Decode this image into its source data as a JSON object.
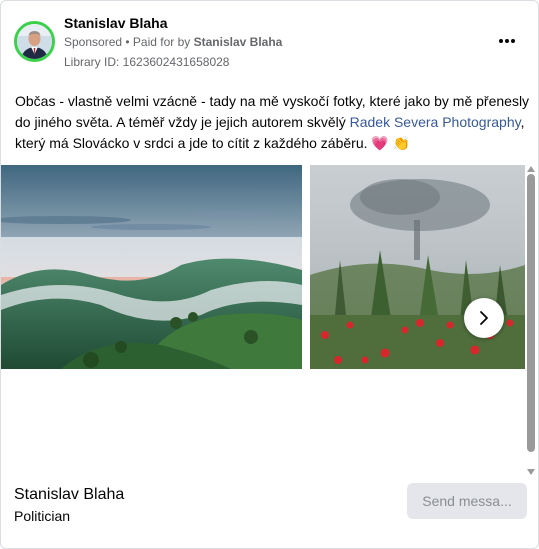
{
  "ad": {
    "advertiser_name": "Stanislav Blaha",
    "sponsored_label": "Sponsored",
    "separator": " • ",
    "paid_for_prefix": "Paid for by ",
    "paid_for_name": "Stanislav Blaha",
    "library_id": "Library ID: 1623602431658028",
    "more_icon": "more-horizontal-icon"
  },
  "post": {
    "text_part1": "Občas - vlastně velmi vzácně - tady na mě vyskočí fotky, které jako by mě přenesly do jiného světa. A téměř vždy je jejich autorem skvělý ",
    "link_text": "Radek Severa Photography",
    "text_part2": ", který má Slovácko v srdci a jde to cítit z každého záběru. ",
    "emoji": "💗 👏"
  },
  "carousel": {
    "images": [
      {
        "name": "misty-valley-sunrise-photo"
      },
      {
        "name": "poppies-vineyard-tree-photo"
      }
    ],
    "next_icon": "chevron-right-icon"
  },
  "footer": {
    "name": "Stanislav Blaha",
    "role": "Politician",
    "send_label": "Send messa..."
  },
  "colors": {
    "link": "#385898",
    "muted": "#65676b",
    "avatar_ring": "#3bd14a",
    "button_bg": "#e4e6eb"
  }
}
